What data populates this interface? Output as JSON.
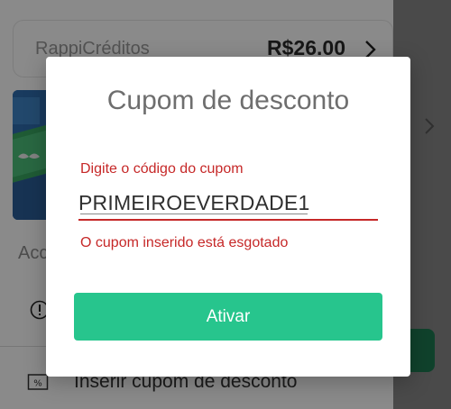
{
  "background": {
    "credits": {
      "label": "RappiCréditos",
      "value": "R$26.00"
    },
    "section_label": "Acc",
    "coupon_row": {
      "label": "Inserir cupom de desconto"
    }
  },
  "dialog": {
    "title": "Cupom de desconto",
    "field": {
      "label": "Digite o código do cupom",
      "value": "PRIMEIROEVERDADE1",
      "error": "O cupom inserido está esgotado"
    },
    "button_label": "Ativar"
  },
  "colors": {
    "accent_green": "#27c58d",
    "error_red": "#c62828",
    "scrim": "rgba(0,0,0,0.46)"
  }
}
